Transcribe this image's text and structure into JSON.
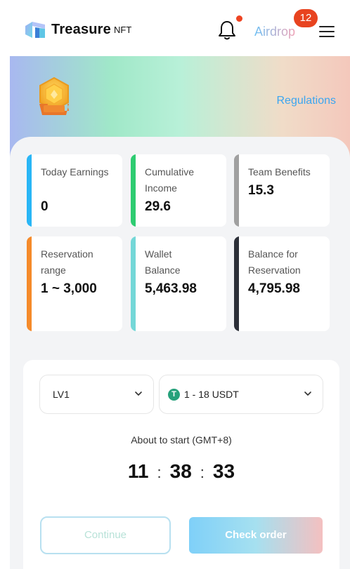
{
  "header": {
    "brand": "Treasure",
    "brand_sub": "NFT",
    "airdrop_label": "Airdrop",
    "notification_count": "12"
  },
  "hero": {
    "regulations_label": "Regulations"
  },
  "stats": [
    {
      "label": "Today Earnings",
      "value": "0",
      "color": "#29b6f6"
    },
    {
      "label": "Cumulative Income",
      "value": "29.6",
      "color": "#2ecc71"
    },
    {
      "label": "Team Benefits",
      "value": "15.3",
      "color": "#a0a0a0"
    },
    {
      "label": "Reservation range",
      "value": "1 ~ 3,000",
      "color": "#f58a2a"
    },
    {
      "label": "Wallet Balance",
      "value": "5,463.98",
      "color": "#74d7d7"
    },
    {
      "label": "Balance for Reservation",
      "value": "4,795.98",
      "color": "#2c2f38"
    }
  ],
  "reservation": {
    "level_select": "LV1",
    "range_select": "1 - 18 USDT",
    "status_text": "About to start (GMT+8)",
    "timer": {
      "hours": "11",
      "minutes": "38",
      "seconds": "33",
      "separator": ":"
    },
    "continue_label": "Continue",
    "check_order_label": "Check order"
  },
  "icons": {
    "bell": "bell-icon",
    "menu": "hamburger-menu-icon",
    "medal": "medal-icon",
    "chevron": "chevron-down-icon",
    "usdt": "tether-icon"
  }
}
